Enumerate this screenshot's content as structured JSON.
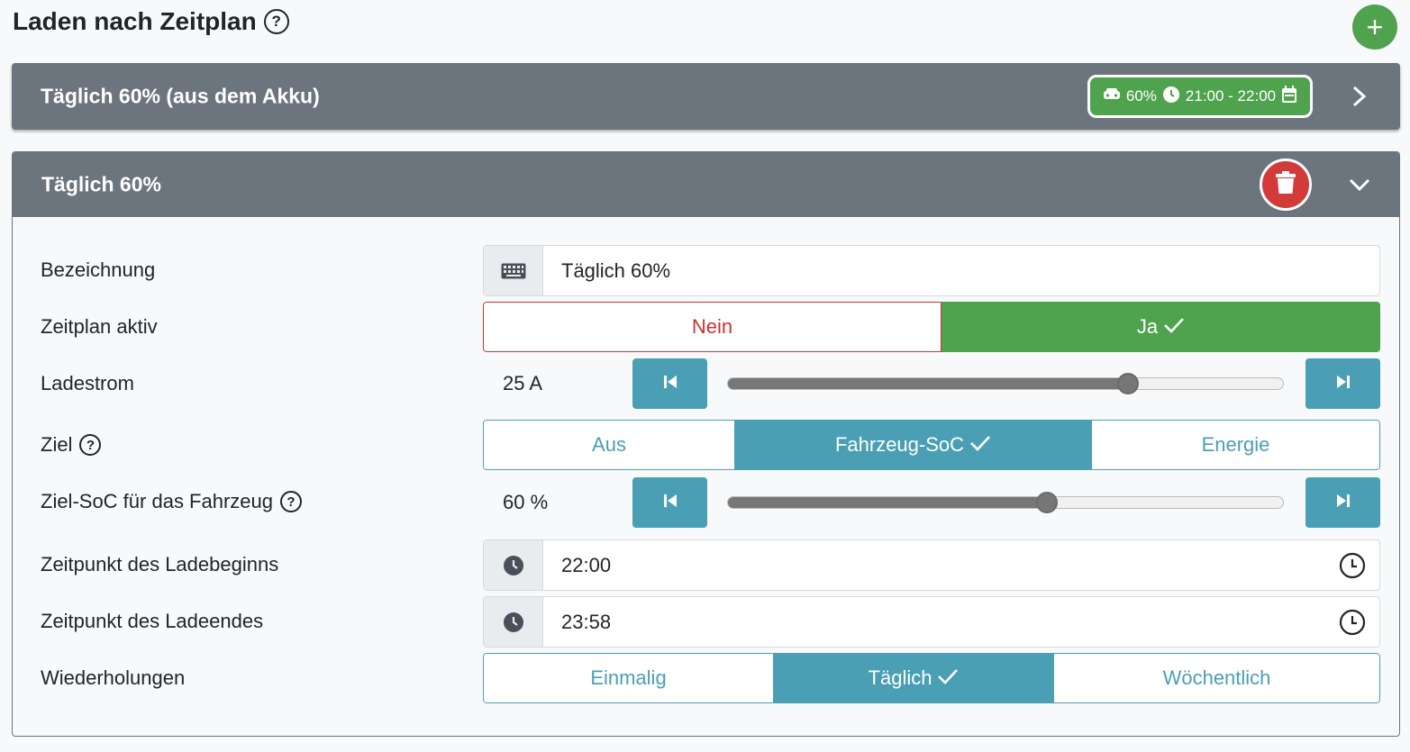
{
  "page": {
    "title": "Laden nach Zeitplan"
  },
  "colors": {
    "header": "#6c757d",
    "green": "#4fa34f",
    "teal": "#4a9fb5",
    "red": "#d33a3a"
  },
  "collapsed_card": {
    "title": "Täglich 60% (aus dem Akku)",
    "badge": {
      "soc": "60%",
      "time": "21:00 - 22:00"
    }
  },
  "open_card": {
    "title": "Täglich 60%",
    "fields": {
      "name": {
        "label": "Bezeichnung",
        "value": "Täglich 60%"
      },
      "active": {
        "label": "Zeitplan aktiv",
        "options": [
          "Nein",
          "Ja"
        ],
        "selected": "Ja"
      },
      "current": {
        "label": "Ladestrom",
        "value_text": "25 A",
        "level": 0.72
      },
      "target": {
        "label": "Ziel",
        "options": [
          "Aus",
          "Fahrzeug-SoC",
          "Energie"
        ],
        "selected": "Fahrzeug-SoC"
      },
      "target_soc": {
        "label": "Ziel-SoC für das Fahrzeug",
        "value_text": "60 %",
        "level": 0.575
      },
      "start": {
        "label": "Zeitpunkt des Ladebeginns",
        "value": "22:00"
      },
      "end": {
        "label": "Zeitpunkt des Ladeendes",
        "value": "23:58"
      },
      "repeat": {
        "label": "Wiederholungen",
        "options": [
          "Einmalig",
          "Täglich",
          "Wöchentlich"
        ],
        "selected": "Täglich"
      }
    }
  }
}
